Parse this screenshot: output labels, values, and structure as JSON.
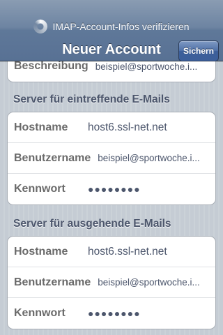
{
  "status": {
    "prompt": "IMAP-Account-Infos verifizieren"
  },
  "nav": {
    "title": "Neuer Account",
    "save_label": "Sichern"
  },
  "top_group": {
    "label": "Beschreibung",
    "value": "beispiel@sportwoche.i..."
  },
  "incoming": {
    "header": "Server für eintreffende E-Mails",
    "rows": [
      {
        "label": "Hostname",
        "value": "host6.ssl-net.net"
      },
      {
        "label": "Benutzername",
        "value": "beispiel@sportwoche.i..."
      },
      {
        "label": "Kennwort",
        "value": "●●●●●●●●"
      }
    ]
  },
  "outgoing": {
    "header": "Server für ausgehende E-Mails",
    "rows": [
      {
        "label": "Hostname",
        "value": "host6.ssl-net.net"
      },
      {
        "label": "Benutzername",
        "value": "beispiel@sportwoche.i..."
      },
      {
        "label": "Kennwort",
        "value": "●●●●●●●●"
      }
    ]
  }
}
